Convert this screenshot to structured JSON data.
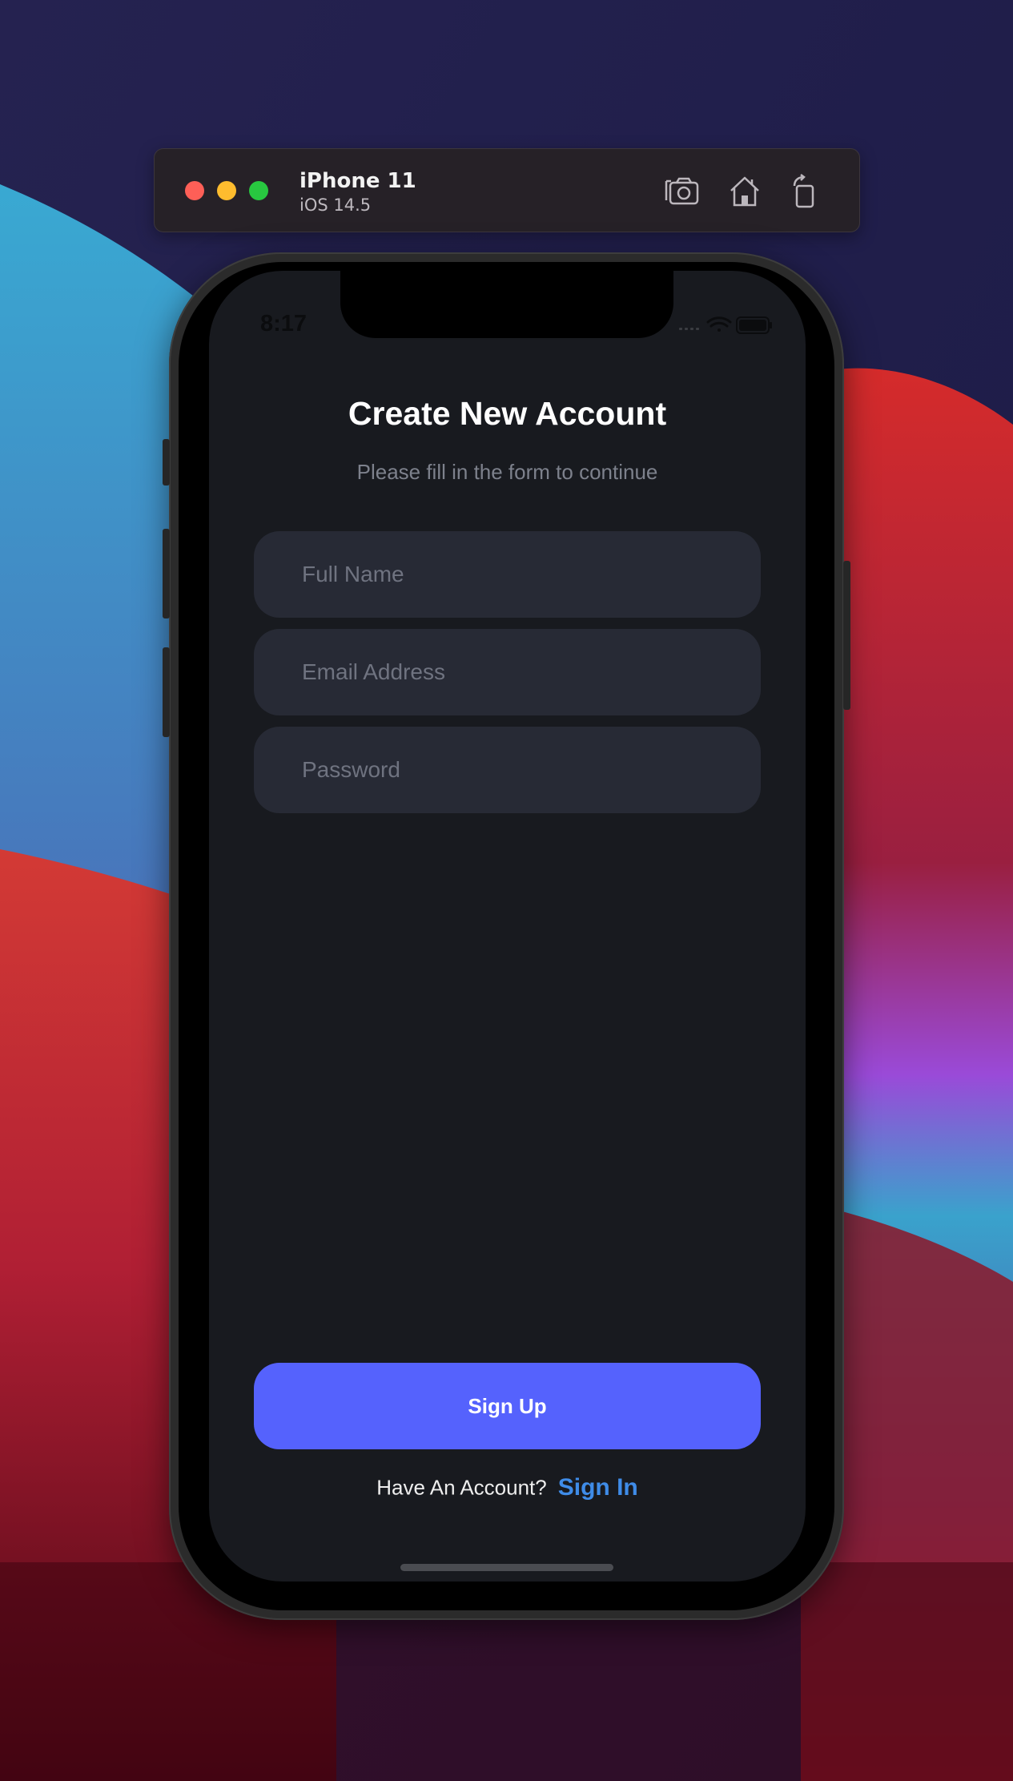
{
  "simulator": {
    "device_name": "iPhone 11",
    "os_version": "iOS 14.5",
    "toolbar_icons": [
      "camera-icon",
      "home-icon",
      "rotate-icon"
    ]
  },
  "status_bar": {
    "time": "8:17"
  },
  "screen": {
    "title": "Create New Account",
    "subtitle": "Please fill in the form to continue",
    "fields": {
      "full_name": {
        "value": "",
        "placeholder": "Full Name"
      },
      "email": {
        "value": "",
        "placeholder": "Email Address"
      },
      "password": {
        "value": "",
        "placeholder": "Password"
      }
    },
    "signup_label": "Sign Up",
    "signin_prompt": "Have An Account?",
    "signin_link": "Sign In"
  },
  "colors": {
    "screen_background": "#181a1f",
    "field_background": "#272a35",
    "primary_button": "#5562fd",
    "link": "#3f8ce8"
  }
}
